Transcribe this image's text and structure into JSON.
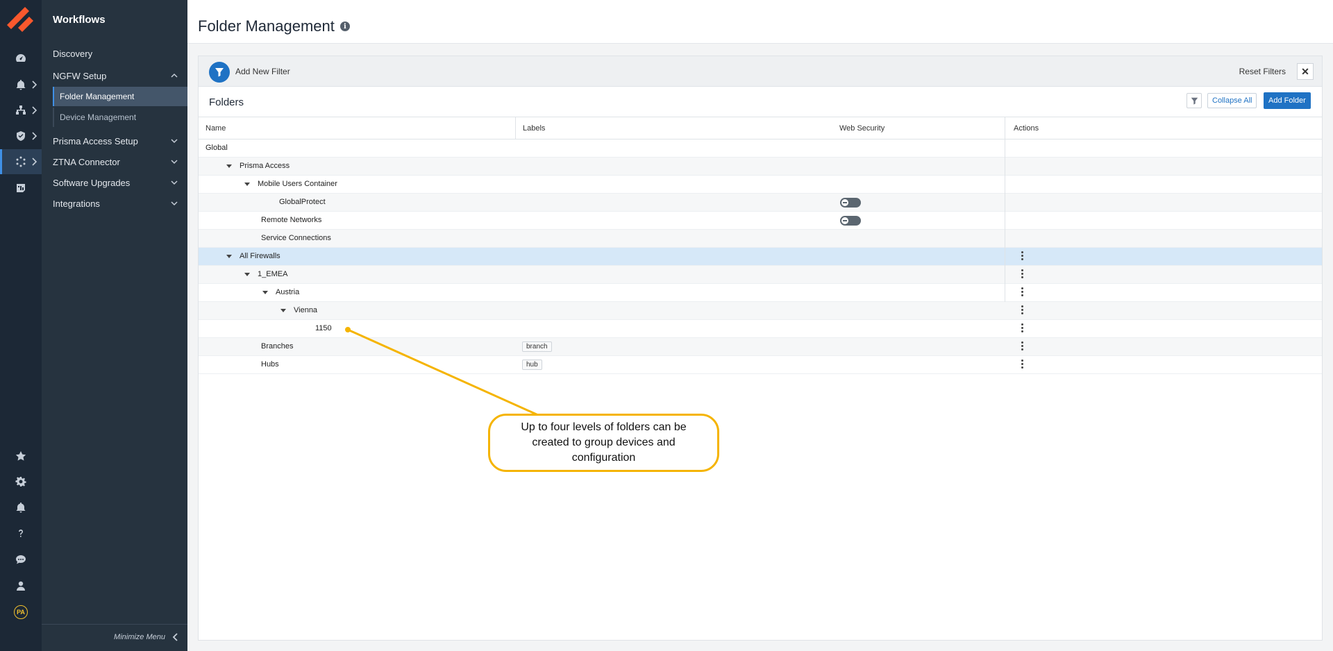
{
  "rail": {
    "items": [
      {
        "icon": "dashboard-icon"
      },
      {
        "icon": "alerts-icon"
      },
      {
        "icon": "network-icon"
      },
      {
        "icon": "security-shield-icon"
      },
      {
        "icon": "workflows-icon"
      },
      {
        "icon": "reports-icon"
      }
    ],
    "bottom": [
      {
        "icon": "star-icon"
      },
      {
        "icon": "gear-icon"
      },
      {
        "icon": "bell-icon"
      },
      {
        "icon": "help-icon"
      },
      {
        "icon": "chat-icon"
      },
      {
        "icon": "user-icon"
      }
    ],
    "avatar": "PA"
  },
  "sidebar": {
    "title": "Workflows",
    "items": [
      {
        "label": "Discovery"
      },
      {
        "label": "NGFW Setup"
      },
      {
        "label": "Folder Management"
      },
      {
        "label": "Device Management"
      },
      {
        "label": "Prisma Access Setup"
      },
      {
        "label": "ZTNA Connector"
      },
      {
        "label": "Software Upgrades"
      },
      {
        "label": "Integrations"
      }
    ],
    "minimize": "Minimize Menu"
  },
  "header": {
    "title": "Folder Management"
  },
  "filterbar": {
    "add_filter": "Add New Filter",
    "reset": "Reset Filters"
  },
  "folders": {
    "title": "Folders",
    "collapse_all": "Collapse All",
    "add_folder": "Add Folder",
    "columns": [
      "Name",
      "Labels",
      "Web Security",
      "Actions"
    ],
    "rows": [
      {
        "name": "Global",
        "label": "",
        "toggle": false,
        "actions": false
      },
      {
        "name": "Prisma Access",
        "label": "",
        "toggle": false,
        "actions": false
      },
      {
        "name": "Mobile Users Container",
        "label": "",
        "toggle": false,
        "actions": false
      },
      {
        "name": "GlobalProtect",
        "label": "",
        "toggle": true,
        "actions": false
      },
      {
        "name": "Remote Networks",
        "label": "",
        "toggle": true,
        "actions": false
      },
      {
        "name": "Service Connections",
        "label": "",
        "toggle": false,
        "actions": false
      },
      {
        "name": "All Firewalls",
        "label": "",
        "toggle": false,
        "actions": true
      },
      {
        "name": "1_EMEA",
        "label": "",
        "toggle": false,
        "actions": true
      },
      {
        "name": "Austria",
        "label": "",
        "toggle": false,
        "actions": true
      },
      {
        "name": "Vienna",
        "label": "",
        "toggle": false,
        "actions": true
      },
      {
        "name": "1150",
        "label": "",
        "toggle": false,
        "actions": true
      },
      {
        "name": "Branches",
        "label": "branch",
        "toggle": false,
        "actions": true
      },
      {
        "name": "Hubs",
        "label": "hub",
        "toggle": false,
        "actions": true
      }
    ]
  },
  "callout": {
    "text": "Up to four levels of folders can be created to group devices and configuration"
  },
  "colors": {
    "accent": "#1f72c4",
    "rail": "#1c2836",
    "sidebar": "#26333f",
    "callout_border": "#f5b400",
    "selected_row": "#d6e8f8"
  }
}
